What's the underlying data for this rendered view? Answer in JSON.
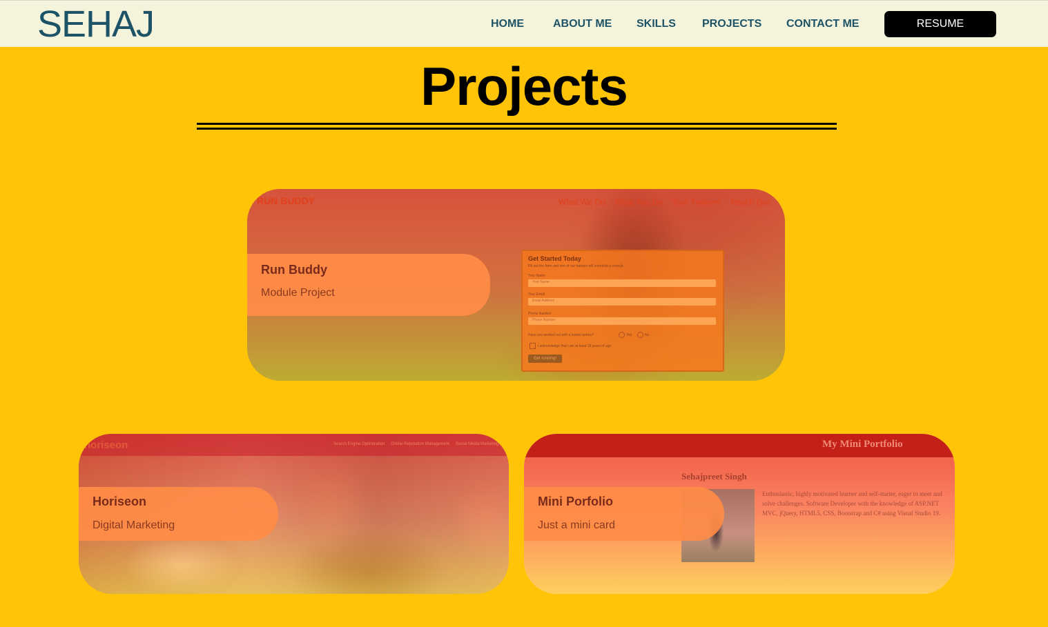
{
  "nav": {
    "brand": "SEHAJ",
    "links": [
      "HOME",
      "ABOUT ME",
      "SKILLS",
      "PROJECTS",
      "CONTACT ME"
    ],
    "resume_label": "RESUME"
  },
  "page": {
    "title": "Projects"
  },
  "colors": {
    "page_background": "#ffc408",
    "navbar_background": "#f4f3dc",
    "nav_text": "#1d5366",
    "resume_button": "#000000"
  },
  "projects": [
    {
      "title": "Run Buddy",
      "subtitle": "Module Project",
      "preview": {
        "site_name": "RUN BUDDY",
        "nav": [
          "What We Do",
          "What You Do",
          "Your Trainers",
          "Reach Out"
        ],
        "form_title": "Get Started Today",
        "form_intro": "Fill out the form and one of our trainers will schedule a consult",
        "fields": [
          {
            "label": "Your Name",
            "placeholder": "Your Name"
          },
          {
            "label": "Your Email",
            "placeholder": "Email Address"
          },
          {
            "label": "Phone Number",
            "placeholder": "Phone Number"
          }
        ],
        "question": "Have you worked out with a trainer before?",
        "yes": "Yes",
        "no": "No",
        "acknowledge": "I acknowledge that I am at least 18 years of age",
        "submit": "Get running!"
      }
    },
    {
      "title": "Horiseon",
      "subtitle": "Digital Marketing",
      "preview": {
        "site_name": "horiseon",
        "nav": [
          "Search Engine Optimization",
          "Online Reputation Management",
          "Social Media Marketing"
        ]
      }
    },
    {
      "title": "Mini Porfolio",
      "subtitle": "Just a mini card",
      "preview": {
        "header": "My Mini Portfolio",
        "name": "Sehajpreet Singh",
        "bio": "Enthusiastic, highly motivated learner and self-starter, eager to meet and solve challenges. Software Developer with the knowledge of ASP.NET MVC, jQuery, HTML5, CSS, Bootstrap and C# using Visual Studio 19."
      }
    }
  ]
}
